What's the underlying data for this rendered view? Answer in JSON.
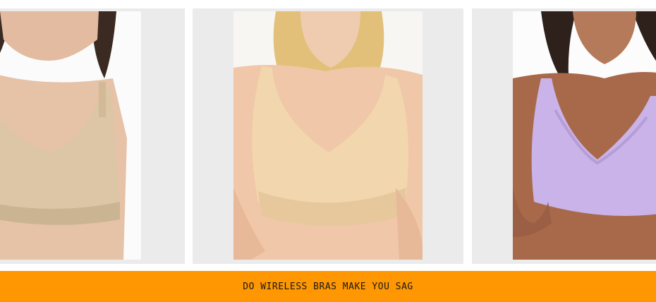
{
  "banner": {
    "title": "DO WIRELESS BRAS MAKE YOU SAG",
    "background": "#fe9701"
  },
  "gallery": {
    "products": [
      {
        "name": "nude-wireless-bra-photo",
        "color": "#dcc6a6"
      },
      {
        "name": "beige-wireless-bra-photo",
        "color": "#f2d6ad"
      },
      {
        "name": "lavender-wireless-bra-photo",
        "color": "#c9b3e8"
      }
    ]
  }
}
